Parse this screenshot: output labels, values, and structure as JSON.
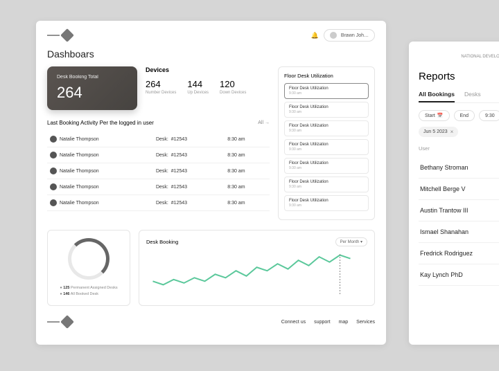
{
  "dashboard": {
    "title": "Dashboars",
    "user": "Brawn Joh…",
    "total_card": {
      "label": "Desk Booking Total",
      "value": "264"
    },
    "devices": {
      "title": "Devices",
      "stats": [
        {
          "num": "264",
          "lbl": "Number Devices"
        },
        {
          "num": "144",
          "lbl": "Up Devices"
        },
        {
          "num": "120",
          "lbl": "Down Devices"
        }
      ]
    },
    "util": {
      "title": "Floor Desk Utilization",
      "items": [
        {
          "name": "Floor Desk Utilization",
          "time": "9:30 am"
        },
        {
          "name": "Floor Desk Utilization",
          "time": "9:30 am"
        },
        {
          "name": "Floor Desk Utilization",
          "time": "9:30 am"
        },
        {
          "name": "Floor Desk Utilization",
          "time": "9:30 am"
        },
        {
          "name": "Floor Desk Utilization",
          "time": "9:30 am"
        },
        {
          "name": "Floor Desk Utilization",
          "time": "9:30 am"
        },
        {
          "name": "Floor Desk Utilization",
          "time": "9:30 am"
        }
      ]
    },
    "activity": {
      "title": "Last Booking Activity Per the logged in user",
      "link": "All →",
      "rows": [
        {
          "name": "Natalie Thompson",
          "desk_lbl": "Desk:",
          "desk": "#12543",
          "time": "8:30 am"
        },
        {
          "name": "Natalie Thompson",
          "desk_lbl": "Desk:",
          "desk": "#12543",
          "time": "8:30 am"
        },
        {
          "name": "Natalie Thompson",
          "desk_lbl": "Desk:",
          "desk": "#12543",
          "time": "8:30 am"
        },
        {
          "name": "Natalie Thompson",
          "desk_lbl": "Desk:",
          "desk": "#12543",
          "time": "8:30 am"
        },
        {
          "name": "Natalie Thompson",
          "desk_lbl": "Desk:",
          "desk": "#12543",
          "time": "8:30 am"
        }
      ]
    },
    "donut": {
      "legend": [
        {
          "val": "125",
          "lbl": "Permanent Assigned Desks"
        },
        {
          "val": "146",
          "lbl": "All Booked Desk"
        }
      ]
    },
    "line": {
      "title": "Desk Booking",
      "filter": "Per Month ▾"
    },
    "footer": {
      "links": [
        "Connect us",
        "support",
        "map",
        "Services"
      ]
    }
  },
  "reports": {
    "brand": "NATIONAL DEVELOPMENT FUND",
    "title": "Reports",
    "tabs": [
      "All Bookings",
      "Desks"
    ],
    "filters": {
      "start": "Start",
      "end": "End",
      "time": "9:30"
    },
    "chips": [
      "Jun 5 2023"
    ],
    "user_head": "User",
    "users": [
      "Bethany Stroman",
      "Mitchell Berge V",
      "Austin Trantow III",
      "Ismael Shanahan",
      "Fredrick Rodriguez",
      "Kay Lynch PhD"
    ]
  },
  "chart_data": {
    "type": "line",
    "title": "Desk Booking",
    "x": [
      0,
      1,
      2,
      3,
      4,
      5,
      6,
      7,
      8,
      9,
      10,
      11,
      12,
      13,
      14,
      15,
      16,
      17,
      18,
      19
    ],
    "values": [
      18,
      14,
      20,
      16,
      22,
      18,
      26,
      22,
      30,
      24,
      34,
      30,
      38,
      32,
      42,
      36,
      46,
      40,
      48,
      44
    ],
    "ylim": [
      0,
      50
    ],
    "color": "#5bc89b"
  }
}
